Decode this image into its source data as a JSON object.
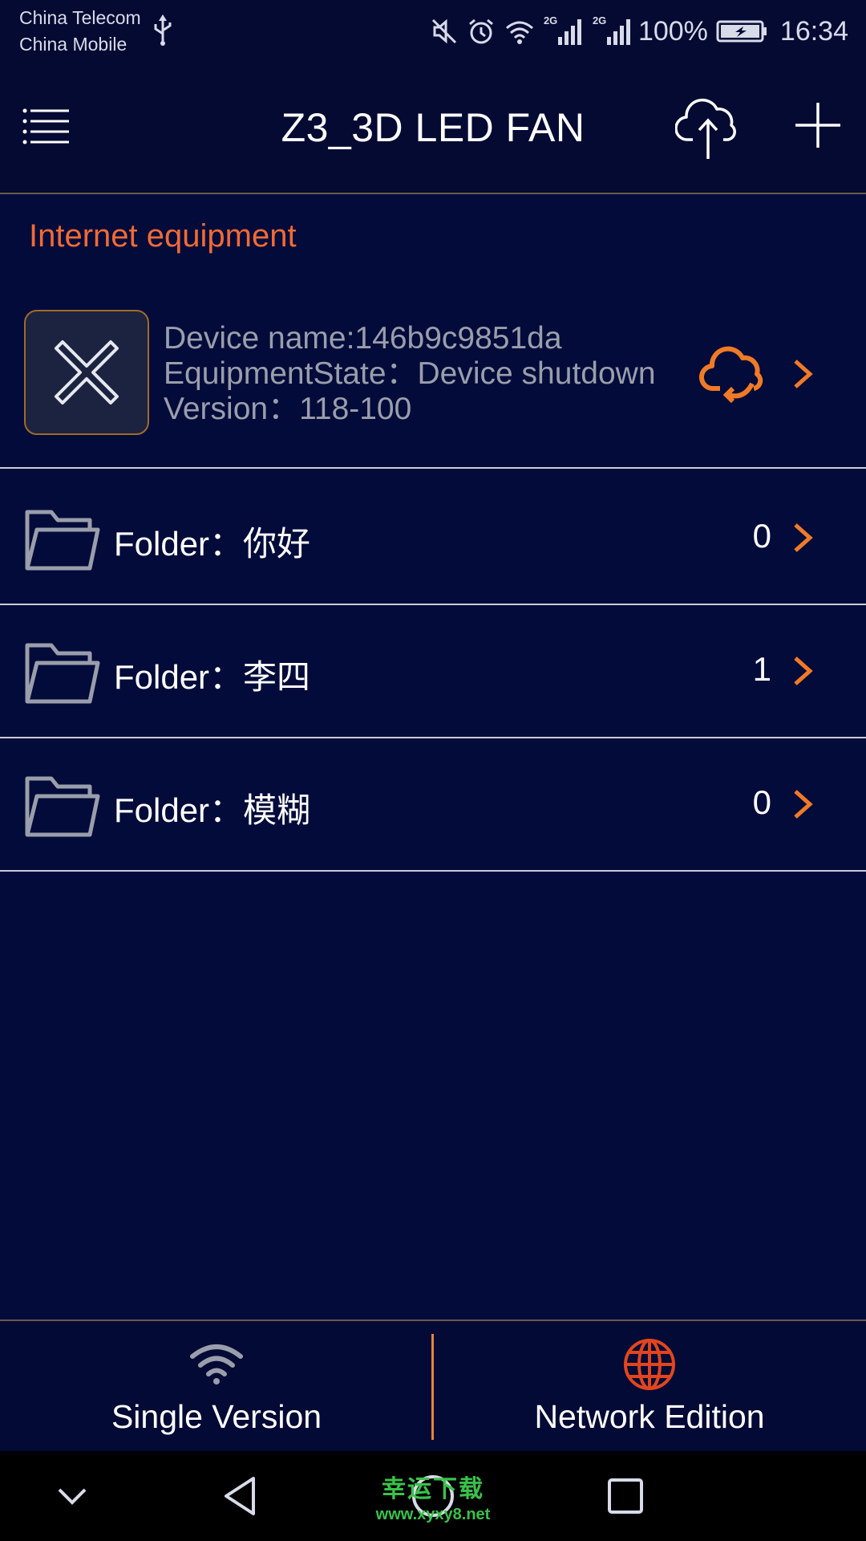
{
  "status_bar": {
    "carrier_1": "China Telecom",
    "carrier_2": "China Mobile",
    "network_1": "2G",
    "network_2": "2G",
    "battery": "100%",
    "time": "16:34"
  },
  "app_bar": {
    "title": "Z3_3D LED FAN"
  },
  "section": {
    "title": "Internet equipment"
  },
  "device": {
    "name": "Device name:146b9c9851da",
    "state": "EquipmentState：Device shutdown",
    "version": "Version：118-100"
  },
  "folders": [
    {
      "label": "Folder：你好",
      "count": "0"
    },
    {
      "label": "Folder：李四",
      "count": "1"
    },
    {
      "label": "Folder：模糊",
      "count": "0"
    }
  ],
  "tabs": {
    "single": "Single Version",
    "network": "Network Edition"
  },
  "watermark": {
    "text": "幸运下载",
    "url": "www.xyxy8.net"
  },
  "colors": {
    "background": "#020b3a",
    "accent": "#f06a35",
    "muted_text": "#9a9eab"
  },
  "icons": {
    "menu": "menu-icon",
    "upload": "cloud-upload-icon",
    "add": "plus-icon",
    "device": "fan-cross-icon",
    "sync": "cloud-sync-icon",
    "chevron": "chevron-right-icon",
    "folder": "folder-icon",
    "wifi": "wifi-icon",
    "globe": "globe-icon"
  }
}
